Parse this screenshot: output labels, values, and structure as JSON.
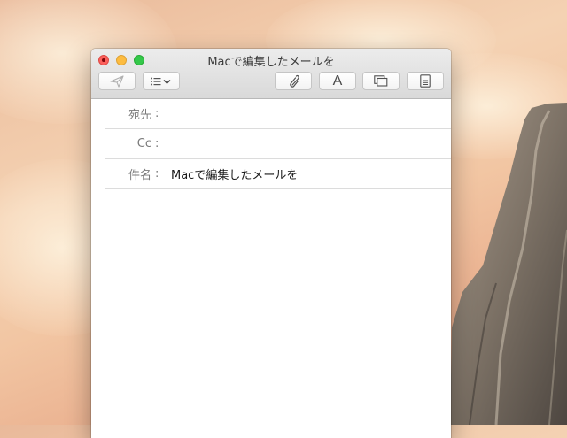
{
  "window": {
    "title": "Macで編集したメールを"
  },
  "toolbar": {
    "buttons": [
      {
        "name": "send",
        "icon": "paper-plane-icon"
      },
      {
        "name": "header-fields",
        "icon": "list-chevron-icon"
      },
      {
        "name": "attach",
        "icon": "paperclip-icon"
      },
      {
        "name": "format",
        "icon": "font-icon",
        "glyph": "A"
      },
      {
        "name": "photo-browser",
        "icon": "windows-icon"
      },
      {
        "name": "stationery",
        "icon": "stationery-icon"
      }
    ]
  },
  "headers": {
    "to_label": "宛先",
    "cc_label": "Cc",
    "subject_label": "件名",
    "colon": ":",
    "to_value": "",
    "cc_value": "",
    "subject_value": "Macで編集したメールを"
  },
  "colors": {
    "close": "#fc605c",
    "minimize": "#fdbc40",
    "maximize": "#34c84a"
  }
}
